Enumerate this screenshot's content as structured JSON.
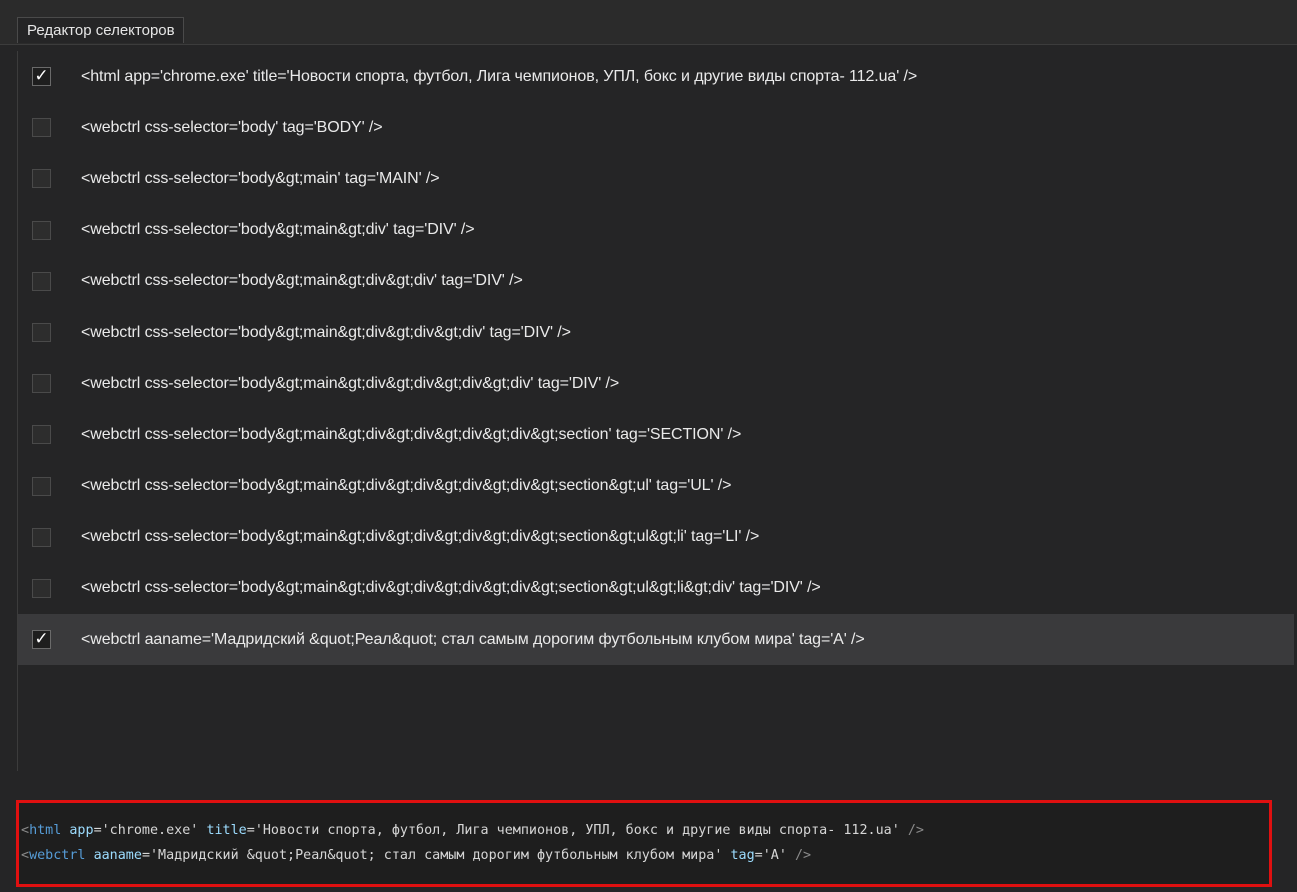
{
  "tab": {
    "title": "Редактор селекторов"
  },
  "rows": [
    {
      "checked": true,
      "text": "<html app='chrome.exe' title='Новости спорта, футбол, Лига чемпионов, УПЛ, бокс и другие виды спорта- 112.ua' />"
    },
    {
      "checked": false,
      "text": "<webctrl css-selector='body' tag='BODY' />"
    },
    {
      "checked": false,
      "text": "<webctrl css-selector='body&gt;main' tag='MAIN' />"
    },
    {
      "checked": false,
      "text": "<webctrl css-selector='body&gt;main&gt;div' tag='DIV' />"
    },
    {
      "checked": false,
      "text": "<webctrl css-selector='body&gt;main&gt;div&gt;div' tag='DIV' />"
    },
    {
      "checked": false,
      "text": "<webctrl css-selector='body&gt;main&gt;div&gt;div&gt;div' tag='DIV' />"
    },
    {
      "checked": false,
      "text": "<webctrl css-selector='body&gt;main&gt;div&gt;div&gt;div&gt;div' tag='DIV' />"
    },
    {
      "checked": false,
      "text": "<webctrl css-selector='body&gt;main&gt;div&gt;div&gt;div&gt;div&gt;section' tag='SECTION' />"
    },
    {
      "checked": false,
      "text": "<webctrl css-selector='body&gt;main&gt;div&gt;div&gt;div&gt;div&gt;section&gt;ul' tag='UL' />"
    },
    {
      "checked": false,
      "text": "<webctrl css-selector='body&gt;main&gt;div&gt;div&gt;div&gt;div&gt;section&gt;ul&gt;li' tag='LI' />"
    },
    {
      "checked": false,
      "text": "<webctrl css-selector='body&gt;main&gt;div&gt;div&gt;div&gt;div&gt;section&gt;ul&gt;li&gt;div' tag='DIV' />"
    },
    {
      "checked": true,
      "text": "<webctrl aaname='Мадридский &quot;Реал&quot; стал самым дорогим футбольным клубом мира' tag='A' />",
      "selected": true
    }
  ],
  "code": {
    "line1": {
      "open": "<",
      "tag": "html",
      "attr1": "app",
      "eq1": "=",
      "val1": "'chrome.exe'",
      "attr2": "title",
      "eq2": "=",
      "val2": "'Новости спорта, футбол, Лига чемпионов, УПЛ, бокс и другие виды спорта- 112.ua'",
      "close": "/>"
    },
    "line2": {
      "open": "<",
      "tag": "webctrl",
      "attr1": "aaname",
      "eq1": "=",
      "val1": "'Мадридский &quot;Реал&quot; стал самым дорогим футбольным клубом мира'",
      "attr2": "tag",
      "eq2": "=",
      "val2": "'A'",
      "close": "/>"
    }
  },
  "colors": {
    "background": "#252526",
    "selected_row": "#3a3a3c",
    "highlight_border": "#e01010",
    "code_tag": "#569cd6",
    "code_attr": "#9cdcfe"
  },
  "check_glyph": "✓"
}
